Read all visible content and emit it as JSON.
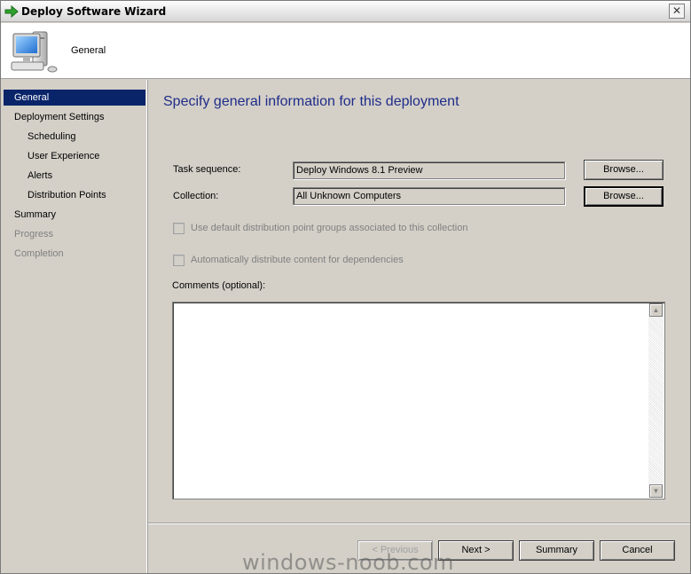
{
  "window": {
    "title": "Deploy Software Wizard",
    "close_glyph": "✕"
  },
  "header": {
    "title": "General",
    "icon": "computer-icon"
  },
  "nav": {
    "items": [
      {
        "label": "General",
        "state": "active"
      },
      {
        "label": "Deployment Settings",
        "state": "normal"
      },
      {
        "label": "Scheduling",
        "state": "normal"
      },
      {
        "label": "User Experience",
        "state": "normal"
      },
      {
        "label": "Alerts",
        "state": "normal"
      },
      {
        "label": "Distribution Points",
        "state": "normal"
      },
      {
        "label": "Summary",
        "state": "normal"
      },
      {
        "label": "Progress",
        "state": "disabled"
      },
      {
        "label": "Completion",
        "state": "disabled"
      }
    ]
  },
  "content": {
    "heading": "Specify general information for this deployment",
    "task_sequence_label": "Task sequence:",
    "task_sequence_value": "Deploy Windows 8.1 Preview",
    "collection_label": "Collection:",
    "collection_value": "All Unknown Computers",
    "browse_label": "Browse...",
    "checkbox_dp_groups": "Use default distribution point groups associated to this collection",
    "checkbox_dependencies": "Automatically distribute content for dependencies",
    "comments_label": "Comments (optional):",
    "comments_value": ""
  },
  "footer": {
    "previous_label": "< Previous",
    "next_label": "Next >",
    "summary_label": "Summary",
    "cancel_label": "Cancel"
  },
  "watermark": "windows-noob.com",
  "colors": {
    "heading": "#1f2c89",
    "nav_active_bg": "#0a246a",
    "dialog_bg": "#d4d0c8"
  }
}
